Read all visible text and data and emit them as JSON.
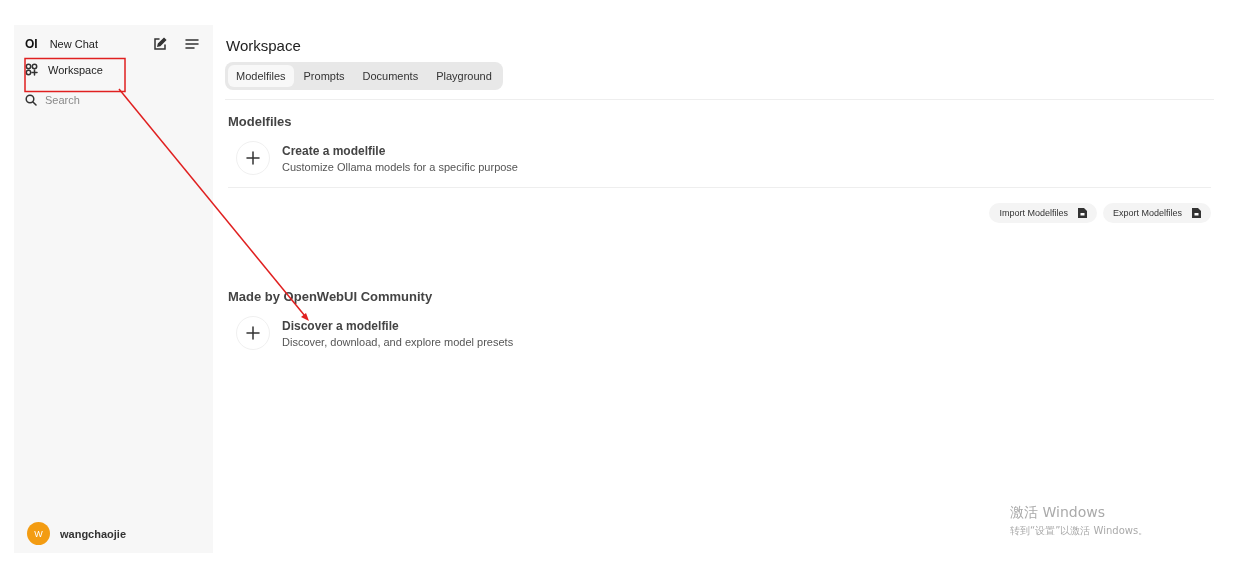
{
  "sidebar": {
    "logo": "OI",
    "new_chat": "New Chat",
    "items": [
      {
        "label": "Workspace",
        "selected": false
      }
    ],
    "search": {
      "placeholder": "Search"
    },
    "user": {
      "initial": "W",
      "name": "wangchaojie"
    }
  },
  "header": {
    "title": "Workspace"
  },
  "tabs": [
    {
      "label": "Modelfiles",
      "selected": true
    },
    {
      "label": "Prompts",
      "selected": false
    },
    {
      "label": "Documents",
      "selected": false
    },
    {
      "label": "Playground",
      "selected": false
    }
  ],
  "sections": [
    {
      "title": "Modelfiles",
      "action": {
        "title": "Create a modelfile",
        "subtitle": "Customize Ollama models for a specific purpose"
      },
      "buttons": [
        "Import Modelfiles",
        "Export Modelfiles"
      ]
    },
    {
      "title": "Made by OpenWebUI Community",
      "action": {
        "title": "Discover a modelfile",
        "subtitle": "Discover, download, and explore model presets"
      }
    }
  ],
  "annotation": {
    "kind": "arrow"
  },
  "os_notice": {
    "title": "激活 Windows",
    "text": "转到“设置”以激活 Windows。"
  }
}
